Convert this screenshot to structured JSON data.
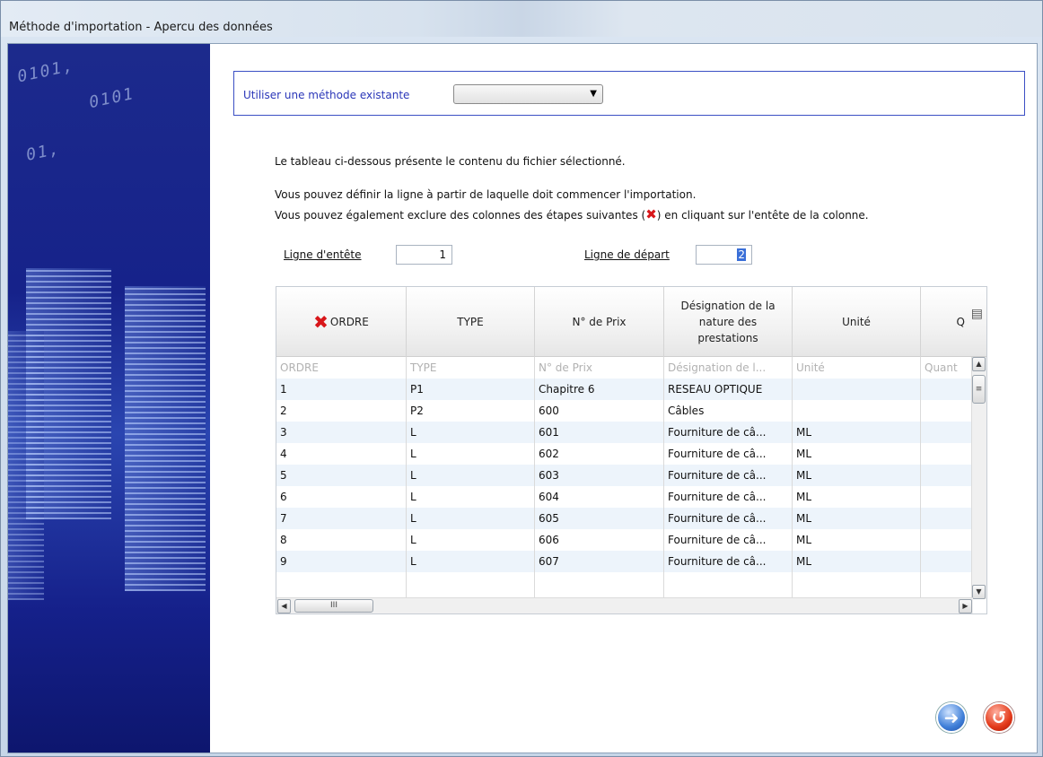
{
  "window": {
    "title": "Méthode d'importation - Apercu des données"
  },
  "method": {
    "label": "Utiliser une méthode existante",
    "selected": ""
  },
  "intro": {
    "line1": "Le tableau ci-dessous présente le contenu du fichier sélectionné.",
    "line2": "Vous pouvez définir la ligne à partir de laquelle doit commencer l'importation.",
    "line3a": "Vous pouvez également exclure des colonnes des étapes suivantes (",
    "line3x": "✖",
    "line3b": ") en cliquant sur l'entête de la colonne."
  },
  "header_line": {
    "label": "Ligne d'entête",
    "value": "1"
  },
  "start_line": {
    "label": "Ligne de départ",
    "value": "2"
  },
  "grid": {
    "columns": [
      {
        "label": "ORDRE",
        "excluded": true
      },
      {
        "label": "TYPE",
        "excluded": false
      },
      {
        "label": "N° de Prix",
        "excluded": false
      },
      {
        "label": "Désignation de la nature des prestations",
        "excluded": false
      },
      {
        "label": "Unité",
        "excluded": false
      },
      {
        "label": "Q",
        "excluded": false
      }
    ],
    "header_row": [
      "ORDRE",
      "TYPE",
      "N° de Prix",
      "Désignation de l...",
      "Unité",
      "Quant"
    ],
    "rows": [
      [
        "1",
        "P1",
        "Chapitre 6",
        "RESEAU OPTIQUE",
        "",
        ""
      ],
      [
        "2",
        "P2",
        "600",
        "Câbles",
        "",
        ""
      ],
      [
        "3",
        "L",
        "601",
        "Fourniture de câ...",
        "ML",
        ""
      ],
      [
        "4",
        "L",
        "602",
        "Fourniture de câ...",
        "ML",
        ""
      ],
      [
        "5",
        "L",
        "603",
        "Fourniture de câ...",
        "ML",
        ""
      ],
      [
        "6",
        "L",
        "604",
        "Fourniture de câ...",
        "ML",
        ""
      ],
      [
        "7",
        "L",
        "605",
        "Fourniture de câ...",
        "ML",
        ""
      ],
      [
        "8",
        "L",
        "606",
        "Fourniture de câ...",
        "ML",
        ""
      ],
      [
        "9",
        "L",
        "607",
        "Fourniture de câ...",
        "ML",
        ""
      ]
    ],
    "hscroll_thumb": "III"
  },
  "colors": {
    "accent": "#2a36b8",
    "exclude": "#d8161a",
    "row_alt": "#edf4fb"
  }
}
